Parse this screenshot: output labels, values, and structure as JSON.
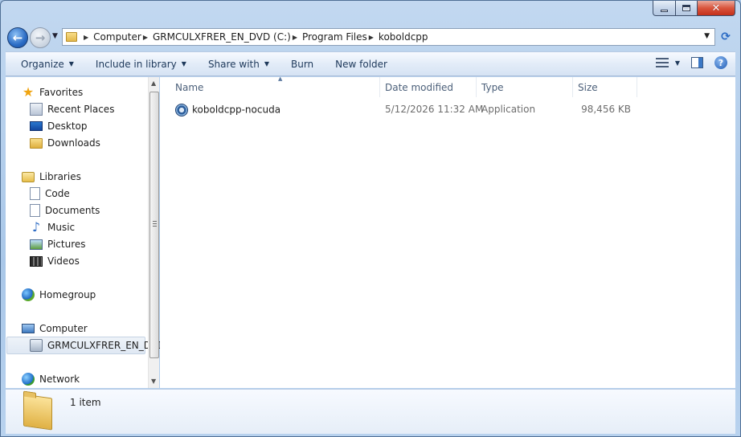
{
  "window": {
    "caption": {
      "minimize": "minimize",
      "maximize": "maximize",
      "close": "close"
    }
  },
  "address": {
    "crumbs": [
      "Computer",
      "GRMCULXFRER_EN_DVD (C:)",
      "Program Files",
      "koboldcpp"
    ],
    "icons": {
      "back": "back-arrow-icon",
      "forward": "forward-arrow-icon",
      "refresh": "refresh-icon"
    }
  },
  "toolbar": {
    "organize": "Organize",
    "include_in_library": "Include in library",
    "share_with": "Share with",
    "burn": "Burn",
    "new_folder": "New folder"
  },
  "sidebar": {
    "favorites": {
      "label": "Favorites",
      "items": [
        "Recent Places",
        "Desktop",
        "Downloads"
      ]
    },
    "libraries": {
      "label": "Libraries",
      "items": [
        "Code",
        "Documents",
        "Music",
        "Pictures",
        "Videos"
      ]
    },
    "homegroup": "Homegroup",
    "computer": {
      "label": "Computer",
      "items": [
        "GRMCULXFRER_EN_DVD"
      ]
    },
    "network": "Network"
  },
  "columns": {
    "name": "Name",
    "date_modified": "Date modified",
    "type": "Type",
    "size": "Size"
  },
  "files": [
    {
      "name": "koboldcpp-nocuda",
      "date_modified": "5/12/2026 11:32 AM",
      "type": "Application",
      "size": "98,456 KB",
      "icon": "application-icon"
    }
  ],
  "status": {
    "item_count": "1 item"
  },
  "colors": {
    "accent": "#2a6bc4",
    "frame": "#a9c7e8"
  }
}
